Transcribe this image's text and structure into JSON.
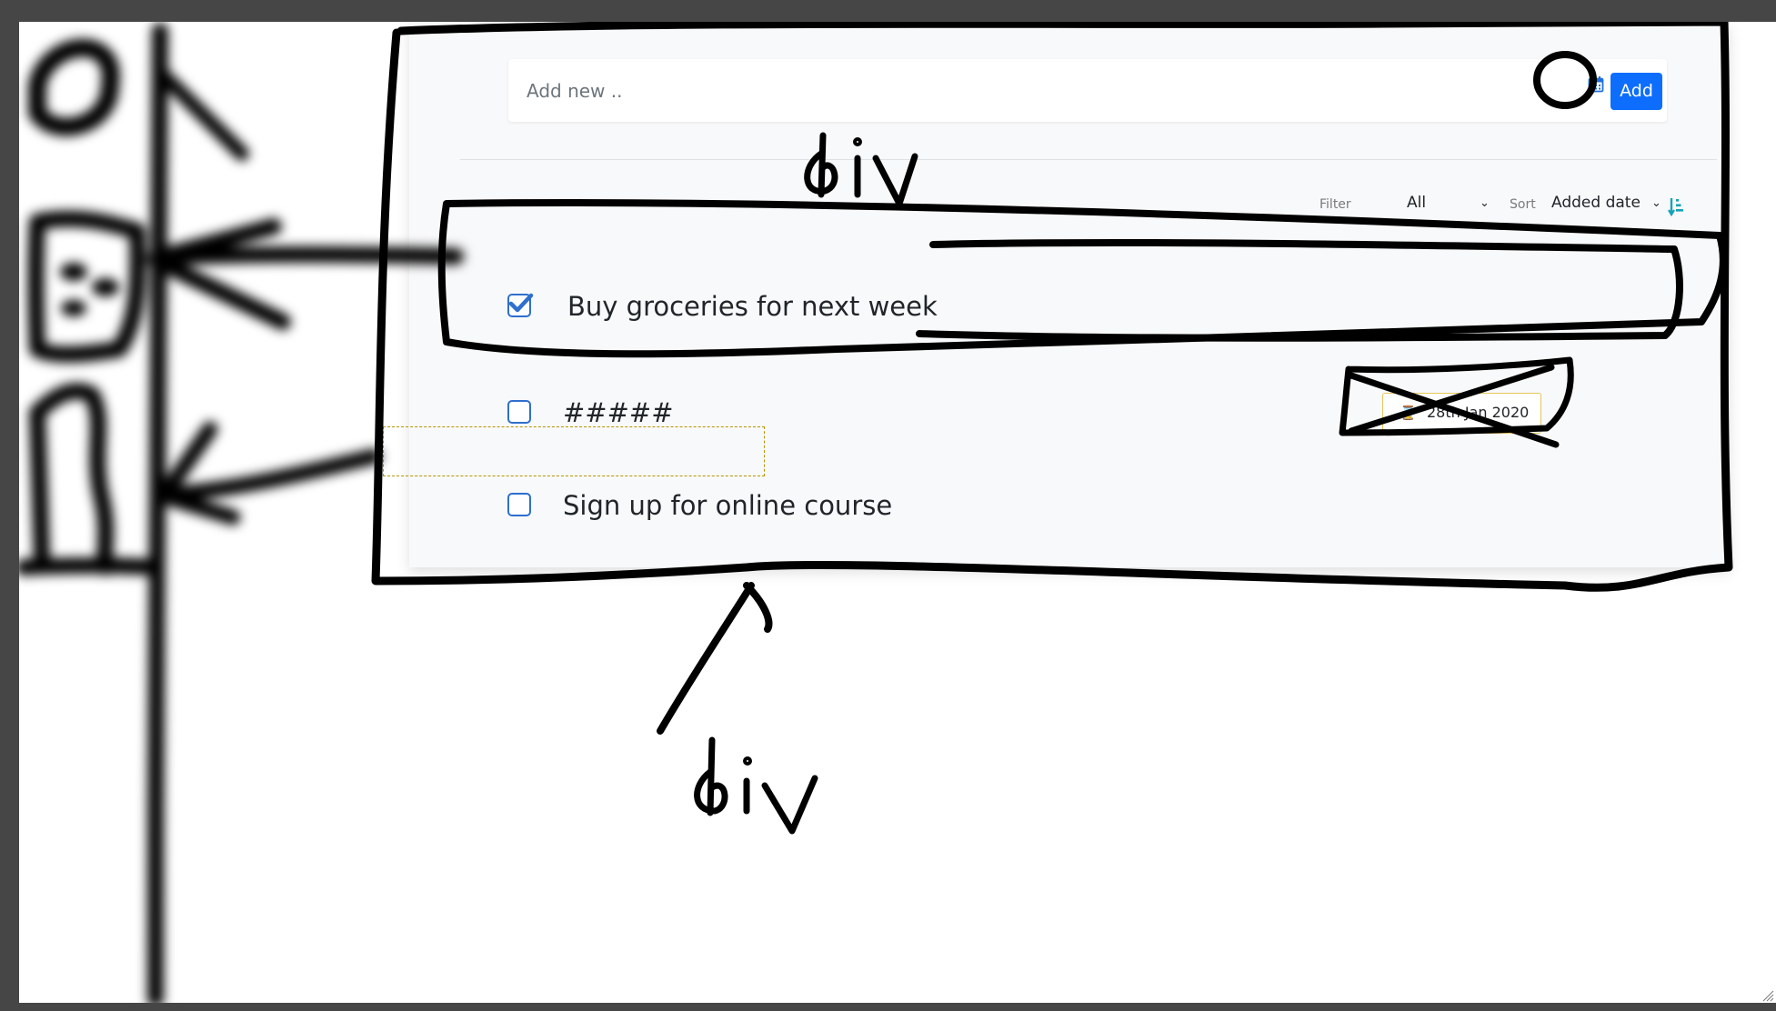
{
  "todo_app": {
    "add_input": {
      "placeholder": "Add new ..",
      "value": ""
    },
    "calendar_icon": "calendar-icon",
    "add_button_label": "Add",
    "filter": {
      "label": "Filter",
      "selected": "All"
    },
    "sort": {
      "label": "Sort",
      "selected": "Added date",
      "direction_icon": "sort-ascending-icon"
    },
    "todos": [
      {
        "text": "Buy groceries for next week",
        "completed": true
      },
      {
        "text": "#####",
        "completed": false,
        "due_date": "28th Jan 2020",
        "due_icon": "hourglass-icon"
      },
      {
        "text": "Sign up for online course",
        "completed": false
      }
    ]
  },
  "sketch_annotations": {
    "labels": [
      "div",
      "div"
    ],
    "colors": {
      "ink": "#000000",
      "primary": "#0d6efd",
      "checkbox": "#2f6fce",
      "badge_border": "#e5c55a",
      "marquee": "#b59500",
      "frame": "#464646"
    }
  }
}
